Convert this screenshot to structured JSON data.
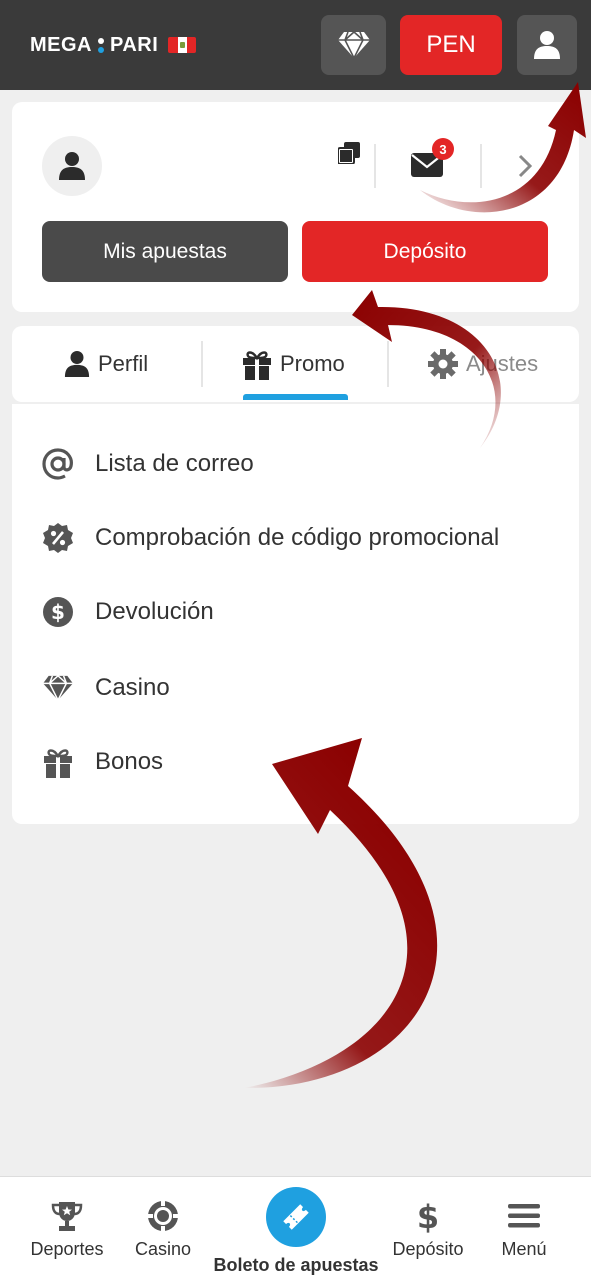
{
  "header": {
    "logo_left": "MEGA",
    "logo_right": "PARI",
    "currency": "PEN",
    "diamond_icon": "diamond-icon",
    "user_icon": "user-icon",
    "colors": {
      "bar": "#3a3a3a",
      "accent": "#e32626",
      "blue": "#1fa0e0"
    }
  },
  "profile": {
    "avatar_icon": "user-icon",
    "mail_badge": "3",
    "my_bets": "Mis apuestas",
    "deposit": "Depósito"
  },
  "tabs": [
    {
      "label": "Perfil",
      "icon": "user-icon"
    },
    {
      "label": "Promo",
      "icon": "gift-icon",
      "active": true
    },
    {
      "label": "Ajustes",
      "icon": "gear-icon"
    }
  ],
  "menu": [
    {
      "label": "Lista de correo",
      "icon": "at-icon"
    },
    {
      "label": "Comprobación de código promocional",
      "icon": "percent-badge-icon"
    },
    {
      "label": "Devolución",
      "icon": "dollar-circle-icon"
    },
    {
      "label": "Casino",
      "icon": "diamond-icon"
    },
    {
      "label": "Bonos",
      "icon": "gift-icon"
    }
  ],
  "bottom_nav": [
    {
      "label": "Deportes",
      "icon": "trophy-icon"
    },
    {
      "label": "Casino",
      "icon": "chip-icon"
    },
    {
      "label": "Boleto de apuestas",
      "icon": "ticket-icon"
    },
    {
      "label": "Depósito",
      "icon": "dollar-icon"
    },
    {
      "label": "Menú",
      "icon": "hamburger-icon"
    }
  ]
}
